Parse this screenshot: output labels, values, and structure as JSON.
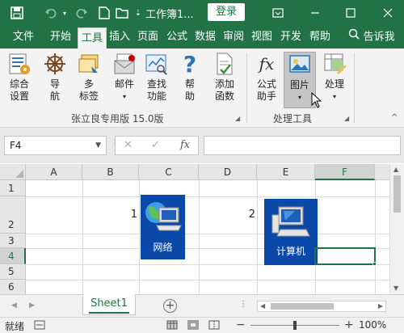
{
  "titlebar": {
    "title": "工作簿1...",
    "login_label": "登录",
    "controls": [
      "save-icon",
      "undo-icon",
      "redo-icon",
      "new-file-icon",
      "folder-icon",
      "customize-quick-access-icon",
      "ribbon-display-icon",
      "minimize-icon",
      "restore-icon",
      "close-icon"
    ]
  },
  "tabs": [
    {
      "label": "文件",
      "active": false
    },
    {
      "label": "开始",
      "active": false
    },
    {
      "label": "工具",
      "active": true
    },
    {
      "label": "插入",
      "active": false
    },
    {
      "label": "页面",
      "active": false
    },
    {
      "label": "公式",
      "active": false
    },
    {
      "label": "数据",
      "active": false
    },
    {
      "label": "审阅",
      "active": false
    },
    {
      "label": "视图",
      "active": false
    },
    {
      "label": "开发",
      "active": false
    },
    {
      "label": "帮助",
      "active": false
    }
  ],
  "tell_me": {
    "label": "告诉我",
    "icon": "lightbulb-icon"
  },
  "ribbon": {
    "groups": [
      {
        "label": "张立良专用版 15.0版",
        "buttons": [
          {
            "label1": "综合",
            "label2": "设置",
            "icon": "settings-icon"
          },
          {
            "label1": "导",
            "label2": "航",
            "icon": "ship-wheel-icon"
          },
          {
            "label1": "多",
            "label2": "标签",
            "icon": "multi-tab-icon"
          },
          {
            "label1": "邮件",
            "label2": "",
            "icon": "mail-icon"
          },
          {
            "label1": "查找",
            "label2": "功能",
            "icon": "search-function-icon"
          },
          {
            "label1": "帮",
            "label2": "助",
            "icon": "help-icon"
          },
          {
            "label1": "添加",
            "label2": "函数",
            "icon": "add-function-icon"
          }
        ]
      },
      {
        "label": "处理工具",
        "buttons": [
          {
            "label1": "公式",
            "label2": "助手",
            "icon": "fx-icon"
          },
          {
            "label1": "图片",
            "label2": "",
            "icon": "picture-icon"
          },
          {
            "label1": "处理",
            "label2": "",
            "icon": "process-icon"
          }
        ]
      }
    ]
  },
  "formula_bar": {
    "name_box": "F4",
    "cancel_symbol": "✕",
    "enter_symbol": "✓",
    "fx_symbol": "fx",
    "value": ""
  },
  "grid": {
    "columns": [
      "A",
      "B",
      "C",
      "D",
      "E",
      "F"
    ],
    "rows": [
      "1",
      "2",
      "3",
      "4",
      "5",
      "6"
    ],
    "selected_cell": "F4",
    "cells": [
      {
        "ref": "B2",
        "value": "1"
      },
      {
        "ref": "D2",
        "value": "2"
      }
    ],
    "pictures": [
      {
        "label": "网络",
        "icon": "network-computer-icon"
      },
      {
        "label": "计算机",
        "icon": "computer-icon"
      }
    ]
  },
  "sheets": {
    "tabs": [
      "Sheet1"
    ],
    "active": "Sheet1",
    "add_symbol": "+"
  },
  "status": {
    "ready": "就绪",
    "zoom": "100%",
    "zoom_fraction": 0.5
  },
  "colors": {
    "accent": "#217346",
    "picture_bg": "#0b49a8"
  }
}
